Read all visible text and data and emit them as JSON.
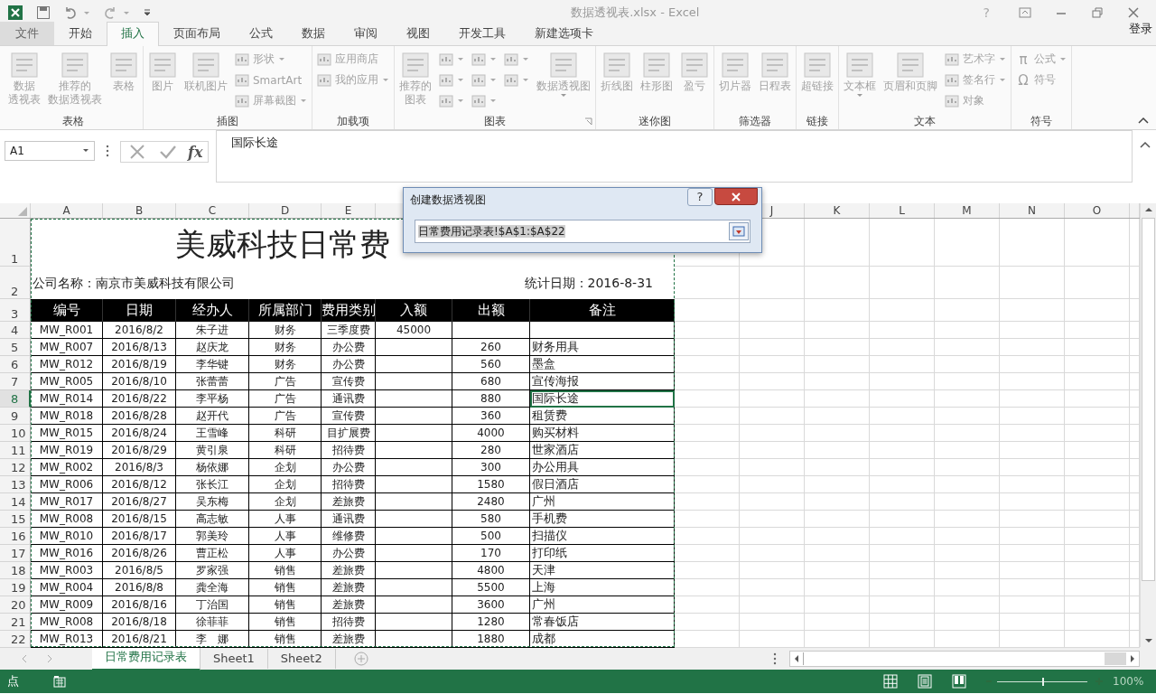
{
  "title_bar": {
    "title": "数据透视表.xlsx - Excel",
    "help": "?"
  },
  "ribbon_tabs": [
    {
      "label": "文件",
      "kind": "file",
      "selected": false
    },
    {
      "label": "开始",
      "kind": "tab",
      "selected": false
    },
    {
      "label": "插入",
      "kind": "tab",
      "selected": true
    },
    {
      "label": "页面布局",
      "kind": "tab",
      "selected": false
    },
    {
      "label": "公式",
      "kind": "tab",
      "selected": false
    },
    {
      "label": "数据",
      "kind": "tab",
      "selected": false
    },
    {
      "label": "审阅",
      "kind": "tab",
      "selected": false
    },
    {
      "label": "视图",
      "kind": "tab",
      "selected": false
    },
    {
      "label": "开发工具",
      "kind": "tab",
      "selected": false
    },
    {
      "label": "新建选项卡",
      "kind": "tab",
      "selected": false
    }
  ],
  "sign_in": "登录",
  "ribbon_groups": [
    {
      "label": "表格",
      "launcher": false,
      "items": [
        {
          "kind": "large",
          "lines": [
            "数据",
            "透视表"
          ],
          "dropdown": false
        },
        {
          "kind": "large",
          "lines": [
            "推荐的",
            "数据透视表"
          ],
          "dropdown": false
        },
        {
          "kind": "large",
          "lines": [
            "表格"
          ],
          "dropdown": false
        }
      ]
    },
    {
      "label": "插图",
      "launcher": false,
      "items": [
        {
          "kind": "large",
          "lines": [
            "图片"
          ],
          "dropdown": false
        },
        {
          "kind": "large",
          "lines": [
            "联机图片"
          ],
          "dropdown": false
        },
        {
          "kind": "stack",
          "entries": [
            {
              "label": "形状",
              "dropdown": true
            },
            {
              "label": "SmartArt",
              "dropdown": false
            },
            {
              "label": "屏幕截图",
              "dropdown": true
            }
          ]
        }
      ]
    },
    {
      "label": "加载项",
      "launcher": false,
      "items": [
        {
          "kind": "stack",
          "entries": [
            {
              "label": "应用商店",
              "dropdown": false
            },
            {
              "label": "我的应用",
              "dropdown": true
            }
          ]
        }
      ]
    },
    {
      "label": "图表",
      "launcher": true,
      "items": [
        {
          "kind": "large",
          "lines": [
            "推荐的",
            "图表"
          ],
          "dropdown": false
        },
        {
          "kind": "stack",
          "entries": [
            {
              "dropdown": true
            },
            {
              "dropdown": true
            },
            {
              "dropdown": true
            }
          ]
        },
        {
          "kind": "stack",
          "entries": [
            {
              "dropdown": true
            },
            {
              "dropdown": true
            },
            {
              "dropdown": true
            }
          ]
        },
        {
          "kind": "stack",
          "entries": [
            {
              "dropdown": true
            },
            {
              "dropdown": true
            }
          ]
        },
        {
          "kind": "large",
          "lines": [
            "数据透视图"
          ],
          "dropdown": true
        }
      ]
    },
    {
      "label": "迷你图",
      "launcher": false,
      "items": [
        {
          "kind": "large",
          "lines": [
            "折线图"
          ],
          "dropdown": false
        },
        {
          "kind": "large",
          "lines": [
            "柱形图"
          ],
          "dropdown": false
        },
        {
          "kind": "large",
          "lines": [
            "盈亏"
          ],
          "dropdown": false
        }
      ]
    },
    {
      "label": "筛选器",
      "launcher": false,
      "items": [
        {
          "kind": "large",
          "lines": [
            "切片器"
          ],
          "dropdown": false
        },
        {
          "kind": "large",
          "lines": [
            "日程表"
          ],
          "dropdown": false
        }
      ]
    },
    {
      "label": "链接",
      "launcher": false,
      "items": [
        {
          "kind": "large",
          "lines": [
            "超链接"
          ],
          "dropdown": false
        }
      ]
    },
    {
      "label": "文本",
      "launcher": false,
      "items": [
        {
          "kind": "large",
          "lines": [
            "文本框"
          ],
          "dropdown": true
        },
        {
          "kind": "large",
          "lines": [
            "页眉和页脚"
          ],
          "dropdown": false
        },
        {
          "kind": "stack",
          "entries": [
            {
              "label": "艺术字",
              "dropdown": true
            },
            {
              "label": "签名行",
              "dropdown": true
            },
            {
              "label": "对象",
              "dropdown": false
            }
          ]
        }
      ]
    },
    {
      "label": "符号",
      "launcher": false,
      "items": [
        {
          "kind": "stack",
          "entries": [
            {
              "glyph": "π",
              "label": "公式",
              "dropdown": true
            },
            {
              "glyph": "Ω",
              "label": "符号",
              "dropdown": false
            }
          ]
        }
      ]
    }
  ],
  "formula_bar": {
    "name_box": "A1",
    "function_label": "fx",
    "content": "国际长途"
  },
  "column_headers_left": [
    "A",
    "B",
    "C",
    "D",
    "E"
  ],
  "column_headers_right": [
    "J",
    "K",
    "L",
    "M",
    "N",
    "O"
  ],
  "row_headers": [
    "1",
    "2",
    "3",
    "4",
    "5",
    "6",
    "7",
    "8",
    "9",
    "10",
    "11",
    "12",
    "13",
    "14",
    "15",
    "16",
    "17",
    "18",
    "19",
    "20",
    "21",
    "22"
  ],
  "sheet": {
    "title": "美威科技日常费",
    "company": "公司名称：南京市美威科技有限公司",
    "report_date": "统计日期：2016-8-31",
    "header": [
      "编号",
      "日期",
      "经办人",
      "所属部门",
      "费用类别",
      "入额",
      "出额",
      "备注"
    ],
    "rows": [
      {
        "id": "MW_R001",
        "date": "2016/8/2",
        "handler": "朱子进",
        "dept": "财务",
        "category": "三季度费",
        "income": "45000",
        "selected": false
      },
      {
        "id": "MW_R007",
        "date": "2016/8/13",
        "handler": "赵庆龙",
        "dept": "财务",
        "category": "办公费",
        "expense": "260",
        "note": "财务用具",
        "selected": false
      },
      {
        "id": "MW_R012",
        "date": "2016/8/19",
        "handler": "李华键",
        "dept": "财务",
        "category": "办公费",
        "expense": "560",
        "note": "墨盒",
        "selected": false
      },
      {
        "id": "MW_R005",
        "date": "2016/8/10",
        "handler": "张蕾蕾",
        "dept": "广告",
        "category": "宣传费",
        "expense": "680",
        "note": "宣传海报",
        "selected": false
      },
      {
        "id": "MW_R014",
        "date": "2016/8/22",
        "handler": "李平杨",
        "dept": "广告",
        "category": "通讯费",
        "expense": "880",
        "note": "国际长途",
        "selected": true
      },
      {
        "id": "MW_R018",
        "date": "2016/8/28",
        "handler": "赵开代",
        "dept": "广告",
        "category": "宣传费",
        "expense": "360",
        "note": "租赁费",
        "selected": false
      },
      {
        "id": "MW_R015",
        "date": "2016/8/24",
        "handler": "王雪峰",
        "dept": "科研",
        "category": "目扩展费",
        "expense": "4000",
        "note": "购买材料",
        "selected": false
      },
      {
        "id": "MW_R019",
        "date": "2016/8/29",
        "handler": "黄引泉",
        "dept": "科研",
        "category": "招待费",
        "expense": "280",
        "note": "世家酒店",
        "selected": false
      },
      {
        "id": "MW_R002",
        "date": "2016/8/3",
        "handler": "杨依娜",
        "dept": "企划",
        "category": "办公费",
        "expense": "300",
        "note": "办公用具",
        "selected": false
      },
      {
        "id": "MW_R006",
        "date": "2016/8/12",
        "handler": "张长江",
        "dept": "企划",
        "category": "招待费",
        "expense": "1580",
        "note": "假日酒店",
        "selected": false
      },
      {
        "id": "MW_R017",
        "date": "2016/8/27",
        "handler": "吴东梅",
        "dept": "企划",
        "category": "差旅费",
        "expense": "2480",
        "note": "广州",
        "selected": false
      },
      {
        "id": "MW_R008",
        "date": "2016/8/15",
        "handler": "高志敏",
        "dept": "人事",
        "category": "通讯费",
        "expense": "580",
        "note": "手机费",
        "selected": false
      },
      {
        "id": "MW_R010",
        "date": "2016/8/17",
        "handler": "郭美玲",
        "dept": "人事",
        "category": "维修费",
        "expense": "500",
        "note": "扫描仪",
        "selected": false
      },
      {
        "id": "MW_R016",
        "date": "2016/8/26",
        "handler": "曹正松",
        "dept": "人事",
        "category": "办公费",
        "expense": "170",
        "note": "打印纸",
        "selected": false
      },
      {
        "id": "MW_R003",
        "date": "2016/8/5",
        "handler": "罗家强",
        "dept": "销售",
        "category": "差旅费",
        "expense": "4800",
        "note": "天津",
        "selected": false
      },
      {
        "id": "MW_R004",
        "date": "2016/8/8",
        "handler": "龚全海",
        "dept": "销售",
        "category": "差旅费",
        "expense": "5500",
        "note": "上海",
        "selected": false
      },
      {
        "id": "MW_R009",
        "date": "2016/8/16",
        "handler": "丁治国",
        "dept": "销售",
        "category": "差旅费",
        "expense": "3600",
        "note": "广州",
        "selected": false
      },
      {
        "id": "MW_R008",
        "date": "2016/8/18",
        "handler": "徐菲菲",
        "dept": "销售",
        "category": "招待费",
        "expense": "1280",
        "note": "常春饭店",
        "selected": false
      },
      {
        "id": "MW_R013",
        "date": "2016/8/21",
        "handler": "李　娜",
        "dept": "销售",
        "category": "差旅费",
        "expense": "1880",
        "note": "成都",
        "selected": false
      }
    ]
  },
  "dialog": {
    "title": "创建数据透视图",
    "help": "?",
    "range": "日常费用记录表!$A$1:$A$22"
  },
  "sheet_tabs": [
    {
      "label": "日常费用记录表",
      "selected": true
    },
    {
      "label": "Sheet1",
      "selected": false
    },
    {
      "label": "Sheet2",
      "selected": false
    }
  ],
  "status_bar": {
    "mode": "点",
    "zoom": "100%",
    "zoom_slider": {
      "level": 0.5
    }
  }
}
